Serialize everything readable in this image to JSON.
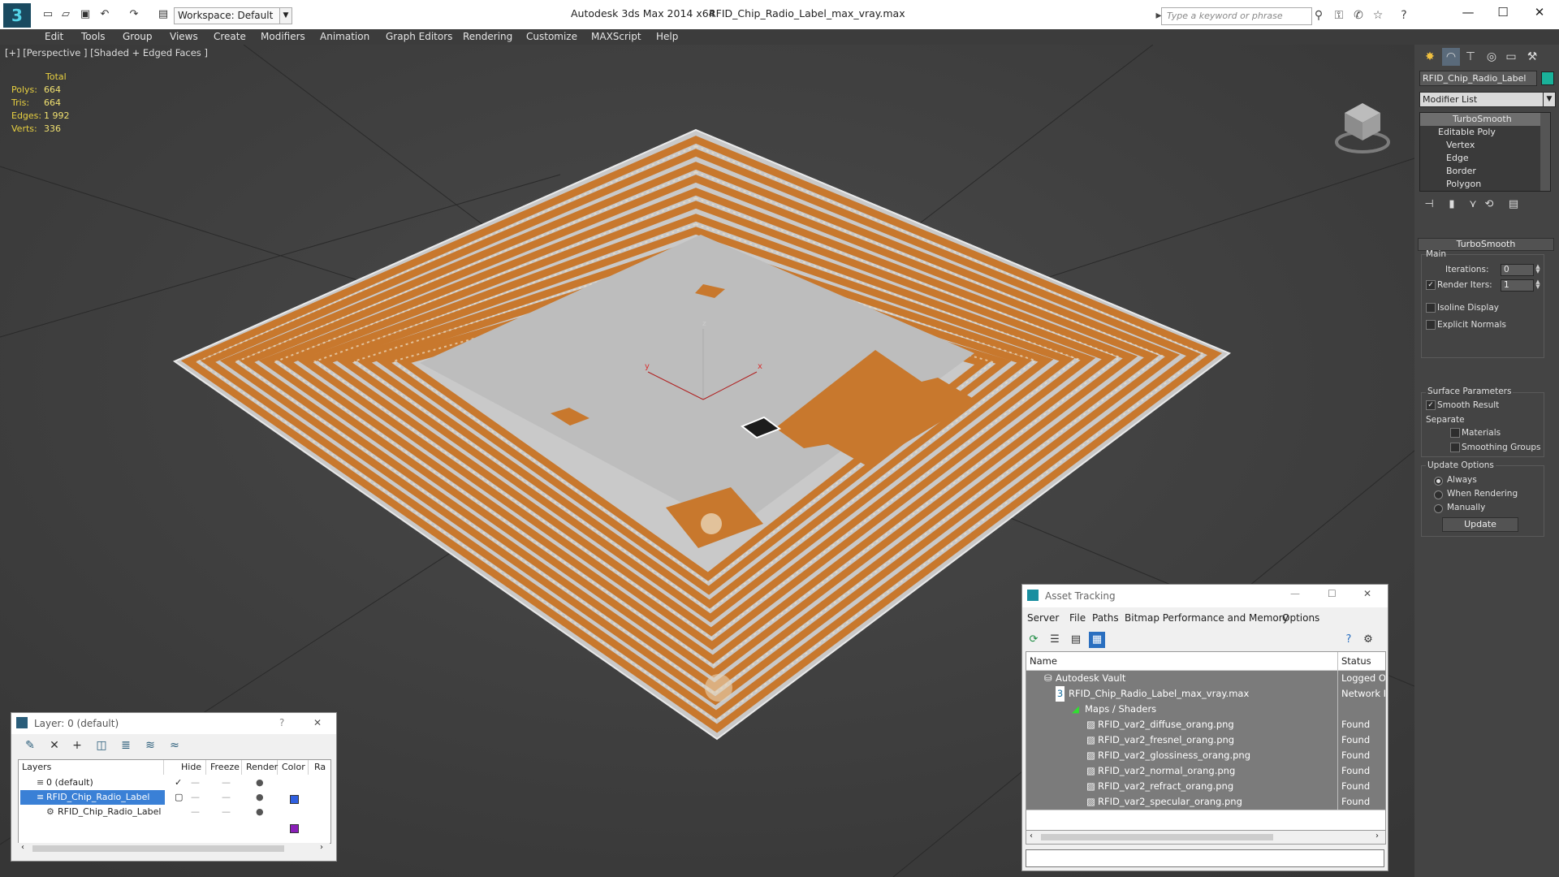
{
  "titlebar": {
    "logo_text": "3",
    "workspace": "Workspace: Default",
    "app_title": "Autodesk 3ds Max  2014 x64",
    "file_title": "RFID_Chip_Radio_Label_max_vray.max",
    "search_placeholder": "Type a keyword or phrase"
  },
  "menu": [
    "Edit",
    "Tools",
    "Group",
    "Views",
    "Create",
    "Modifiers",
    "Animation",
    "Graph Editors",
    "Rendering",
    "Customize",
    "MAXScript",
    "Help"
  ],
  "viewport": {
    "label": "[+] [Perspective ] [Shaded + Edged Faces ]",
    "stats": {
      "header": "Total",
      "rows": [
        {
          "k": "Polys:",
          "v": "664"
        },
        {
          "k": "Tris:",
          "v": "664"
        },
        {
          "k": "Edges:",
          "v": "1 992"
        },
        {
          "k": "Verts:",
          "v": "336"
        }
      ]
    },
    "axis_labels": {
      "z": "z",
      "y": "y",
      "x": "x"
    },
    "colors": {
      "antenna": "#c8782d",
      "substrate": "#bdbdbd",
      "background": "#414141"
    }
  },
  "command_panel": {
    "object_name": "RFID_Chip_Radio_Label",
    "object_color": "#1ab29a",
    "modifier_list": "Modifier List",
    "stack": [
      "TurboSmooth",
      "Editable Poly",
      "Vertex",
      "Edge",
      "Border",
      "Polygon"
    ],
    "turbosmooth": {
      "title": "TurboSmooth",
      "main": "Main",
      "iterations_label": "Iterations:",
      "iterations_value": "0",
      "render_iters_label": "Render Iters:",
      "render_iters_value": "1",
      "isoline": "Isoline Display",
      "explicit_normals": "Explicit Normals",
      "surface_params": "Surface Parameters",
      "smooth_result": "Smooth Result",
      "separate": "Separate",
      "materials": "Materials",
      "smoothing_groups": "Smoothing Groups",
      "update_options": "Update Options",
      "always": "Always",
      "when_rendering": "When Rendering",
      "manually": "Manually",
      "update_button": "Update"
    }
  },
  "layer_window": {
    "title": "Layer: 0 (default)",
    "help": "?",
    "close": "✕",
    "columns": [
      "Layers",
      "Hide",
      "Freeze",
      "Render",
      "Color",
      "Ra"
    ],
    "rows": [
      {
        "name": "0 (default)",
        "color": "#2f5fe0"
      },
      {
        "name": "RFID_Chip_Radio_Label",
        "color": "#8a1fb8"
      },
      {
        "name": "RFID_Chip_Radio_Label",
        "color": "#10a07a"
      }
    ]
  },
  "asset_tracking": {
    "title": "Asset Tracking",
    "menus": [
      "Server",
      "File",
      "Paths",
      "Bitmap Performance and Memory",
      "Options"
    ],
    "columns": [
      "Name",
      "Status"
    ],
    "rows": [
      {
        "name": "Autodesk Vault",
        "status": "Logged Ou",
        "indent": 1
      },
      {
        "name": "RFID_Chip_Radio_Label_max_vray.max",
        "status": "Network Pa",
        "indent": 2
      },
      {
        "name": "Maps / Shaders",
        "status": "",
        "indent": 3
      },
      {
        "name": "RFID_var2_diffuse_orang.png",
        "status": "Found",
        "indent": 4
      },
      {
        "name": "RFID_var2_fresnel_orang.png",
        "status": "Found",
        "indent": 4
      },
      {
        "name": "RFID_var2_glossiness_orang.png",
        "status": "Found",
        "indent": 4
      },
      {
        "name": "RFID_var2_normal_orang.png",
        "status": "Found",
        "indent": 4
      },
      {
        "name": "RFID_var2_refract_orang.png",
        "status": "Found",
        "indent": 4
      },
      {
        "name": "RFID_var2_specular_orang.png",
        "status": "Found",
        "indent": 4
      }
    ]
  }
}
